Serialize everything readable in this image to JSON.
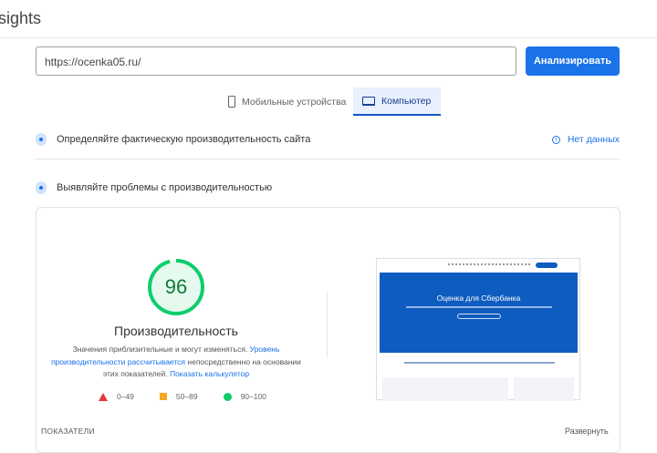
{
  "header": {
    "title": "sights"
  },
  "search": {
    "url": "https://ocenka05.ru/",
    "analyze_label": "Анализировать"
  },
  "tabs": [
    {
      "label": "Мобильные устройства"
    },
    {
      "label": "Компьютер",
      "active": true
    }
  ],
  "field_section": {
    "title": "Определяйте фактическую производительность сайта",
    "status": "Нет данных"
  },
  "lab_section": {
    "title": "Выявляйте проблемы с производительностью"
  },
  "performance": {
    "score": 96,
    "title": "Производительность",
    "desc_text1": "Значения приблизительные и могут изменяться.",
    "desc_link1": "Уровень производительности рассчитывается",
    "desc_text2": "непосредственно на основании этих показателей.",
    "desc_link2": "Показать калькулятор",
    "legend": [
      "0–49",
      "50–89",
      "90–100"
    ],
    "colors": {
      "pass": "#0cce6b",
      "average": "#f5a623",
      "fail": "#e53935"
    }
  },
  "thumbnail": {
    "hero_title": "Оценка для Сбербанка"
  },
  "metrics": {
    "label": "ПОКАЗАТЕЛИ",
    "expand_label": "Развернуть"
  }
}
